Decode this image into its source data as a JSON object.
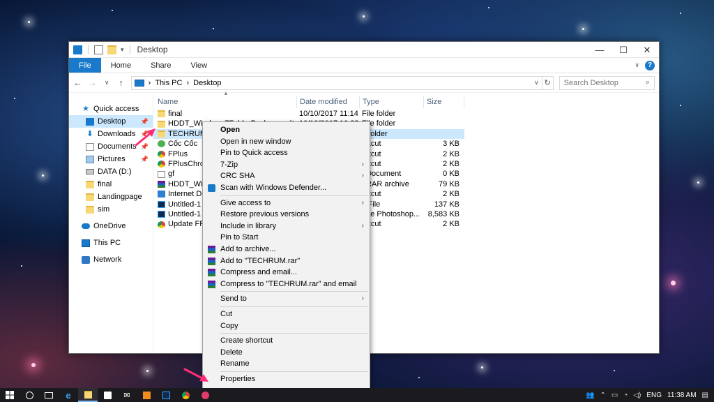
{
  "window": {
    "title": "Desktop",
    "controls": {
      "minimize": "—",
      "maximize": "☐",
      "close": "✕"
    }
  },
  "ribbon": {
    "tabs": [
      "File",
      "Home",
      "Share",
      "View"
    ],
    "chevron": "∨",
    "help": "?"
  },
  "address": {
    "back": "←",
    "forward": "→",
    "recent": "∨",
    "up": "↑",
    "crumbs": [
      "This PC",
      "Desktop"
    ],
    "separator": "›",
    "refresh": "↻",
    "search_placeholder": "Search Desktop"
  },
  "navpane": {
    "quick_access": "Quick access",
    "quick_items": [
      {
        "label": "Desktop",
        "pinned": true
      },
      {
        "label": "Downloads",
        "pinned": true
      },
      {
        "label": "Documents",
        "pinned": true
      },
      {
        "label": "Pictures",
        "pinned": true
      },
      {
        "label": "DATA (D:)",
        "pinned": false
      },
      {
        "label": "final",
        "pinned": false
      },
      {
        "label": "Landingpage",
        "pinned": false
      },
      {
        "label": "sim",
        "pinned": false
      }
    ],
    "onedrive": "OneDrive",
    "thispc": "This PC",
    "network": "Network"
  },
  "columns": {
    "name": "Name",
    "date": "Date modified",
    "type": "Type",
    "size": "Size"
  },
  "files": [
    {
      "name": "final",
      "date": "10/10/2017 11:14 ...",
      "type": "File folder",
      "size": "",
      "icon": "folder"
    },
    {
      "name": "HDDT_Windows7FolderBackgroundChange...",
      "date": "10/10/2017 10:23 ...",
      "type": "File folder",
      "size": "",
      "icon": "folder"
    },
    {
      "name": "TECHRUM",
      "date": "",
      "type": "e folder",
      "size": "",
      "icon": "folder",
      "selected": true
    },
    {
      "name": "Cốc Cốc",
      "date": "",
      "type": "ortcut",
      "size": "3 KB",
      "icon": "coccoc"
    },
    {
      "name": "FPlus",
      "date": "",
      "type": "ortcut",
      "size": "2 KB",
      "icon": "chrome"
    },
    {
      "name": "FPlusChrome",
      "date": "",
      "type": "ortcut",
      "size": "2 KB",
      "icon": "chrome"
    },
    {
      "name": "gf",
      "date": "",
      "type": "t Document",
      "size": "0 KB",
      "icon": "text"
    },
    {
      "name": "HDDT_Windo",
      "date": "",
      "type": "nRAR archive",
      "size": "79 KB",
      "icon": "rar"
    },
    {
      "name": "Internet Dow",
      "date": "",
      "type": "ortcut",
      "size": "2 KB",
      "icon": "shortcut"
    },
    {
      "name": "Untitled-1",
      "date": "",
      "type": "J File",
      "size": "137 KB",
      "icon": "psd"
    },
    {
      "name": "Untitled-1",
      "date": "",
      "type": "obe Photoshop...",
      "size": "8,583 KB",
      "icon": "psd"
    },
    {
      "name": "Update FPlus",
      "date": "",
      "type": "ortcut",
      "size": "2 KB",
      "icon": "chrome"
    }
  ],
  "context_menu": {
    "items": [
      {
        "label": "Open",
        "bold": true
      },
      {
        "label": "Open in new window"
      },
      {
        "label": "Pin to Quick access"
      },
      {
        "label": "7-Zip",
        "submenu": true
      },
      {
        "label": "CRC SHA",
        "submenu": true
      },
      {
        "label": "Scan with Windows Defender...",
        "icon": "defender"
      },
      {
        "sep": true
      },
      {
        "label": "Give access to",
        "submenu": true
      },
      {
        "label": "Restore previous versions"
      },
      {
        "label": "Include in library",
        "submenu": true
      },
      {
        "label": "Pin to Start"
      },
      {
        "label": "Add to archive...",
        "icon": "rar"
      },
      {
        "label": "Add to \"TECHRUM.rar\"",
        "icon": "rar"
      },
      {
        "label": "Compress and email...",
        "icon": "rar"
      },
      {
        "label": "Compress to \"TECHRUM.rar\" and email",
        "icon": "rar"
      },
      {
        "sep": true
      },
      {
        "label": "Send to",
        "submenu": true
      },
      {
        "sep": true
      },
      {
        "label": "Cut"
      },
      {
        "label": "Copy"
      },
      {
        "sep": true
      },
      {
        "label": "Create shortcut"
      },
      {
        "label": "Delete"
      },
      {
        "label": "Rename"
      },
      {
        "sep": true
      },
      {
        "label": "Properties"
      }
    ],
    "submenu_glyph": "›"
  },
  "taskbar": {
    "clock": "11:38 AM",
    "language": "ENG"
  },
  "colors": {
    "accent": "#1979ca",
    "selection": "#cce8ff",
    "arrow": "#ff2d78"
  }
}
